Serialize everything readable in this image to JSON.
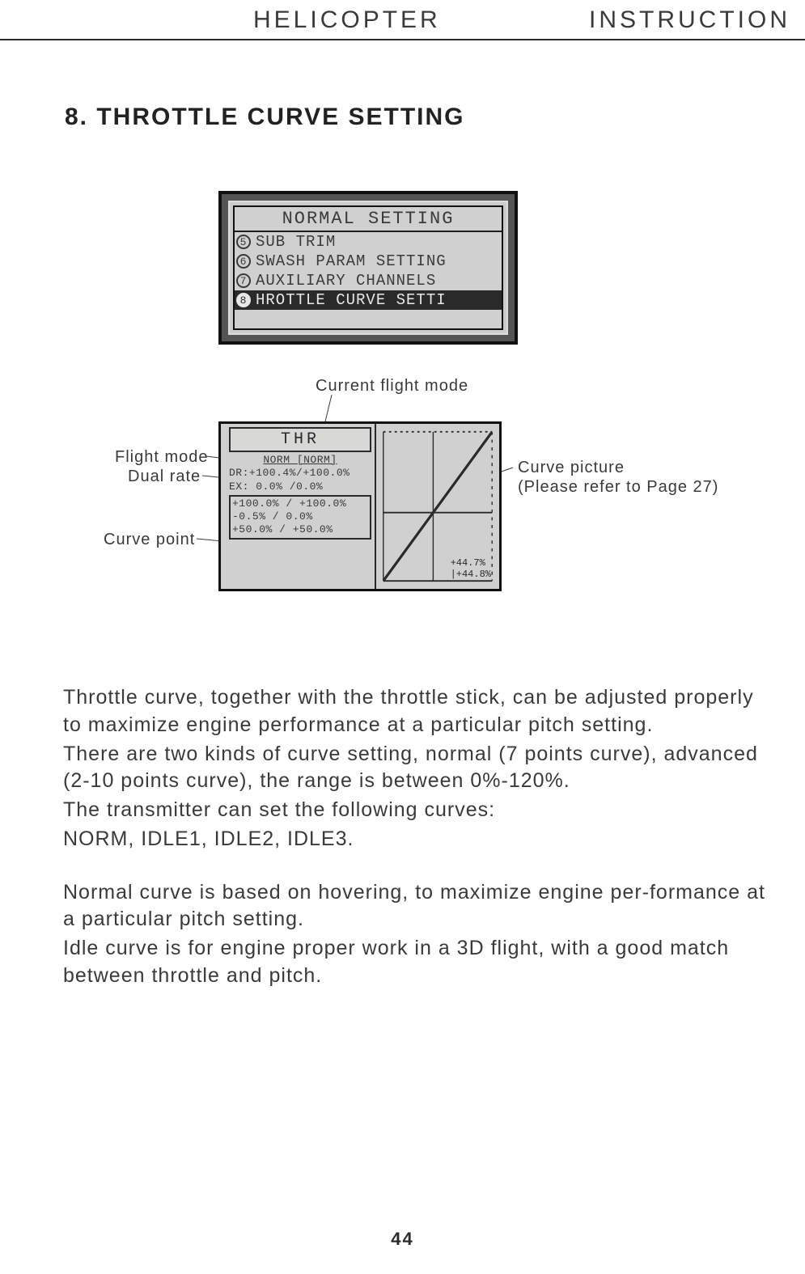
{
  "header": {
    "left": "HELICOPTER",
    "right": "INSTRUCTION"
  },
  "section_title": "8. THROTTLE CURVE SETTING",
  "screen1": {
    "title": "NORMAL SETTING",
    "items": [
      {
        "num": "5",
        "label": "SUB TRIM",
        "selected": false
      },
      {
        "num": "6",
        "label": "SWASH PARAM SETTING",
        "selected": false
      },
      {
        "num": "7",
        "label": "AUXILIARY CHANNELS",
        "selected": false
      },
      {
        "num": "8",
        "label": "HROTTLE CURVE SETTI",
        "selected": true
      }
    ]
  },
  "callouts": {
    "current_flight_mode": "Current flight mode",
    "flight_mode": "Flight mode",
    "dual_rate": "Dual rate",
    "curve_point": "Curve point",
    "curve_picture_line1": "Curve picture",
    "curve_picture_line2": "(Please refer to Page 27)"
  },
  "screen2": {
    "title": "THR",
    "mode_line": "NORM  [NORM]",
    "dr_line": "DR:+100.4%/+100.0%",
    "ex_line": "EX: 0.0%   /0.0%",
    "curve_lines": [
      "+100.0% / +100.0%",
      "-0.5%  / 0.0%",
      "+50.0% / +50.0%"
    ],
    "readout": [
      "+44.7%",
      "|+44.8%"
    ]
  },
  "chart_data": {
    "type": "line",
    "x": [
      0,
      50,
      100
    ],
    "values": [
      0,
      50,
      100
    ],
    "title": "THR",
    "xlabel": "",
    "ylabel": "",
    "xlim": [
      0,
      100
    ],
    "ylim": [
      0,
      100
    ],
    "cursor": {
      "x": 44.8,
      "y": 44.7
    },
    "readout": [
      "+44.7%",
      "+44.8%"
    ]
  },
  "body": {
    "p1": "Throttle curve, together with the throttle stick, can be adjusted properly to maximize engine performance at a particular pitch setting.",
    "p2": "There are two kinds of curve setting, normal (7 points curve), advanced (2-10 points curve), the range is between 0%-120%.",
    "p3": "The transmitter can set the following curves:",
    "p4": "NORM, IDLE1, IDLE2, IDLE3.",
    "p5": "Normal curve is based on hovering, to maximize engine per-formance at a particular pitch setting.",
    "p6": "Idle curve is for engine proper work in a 3D flight, with a good match between throttle and pitch."
  },
  "page_number": "44"
}
